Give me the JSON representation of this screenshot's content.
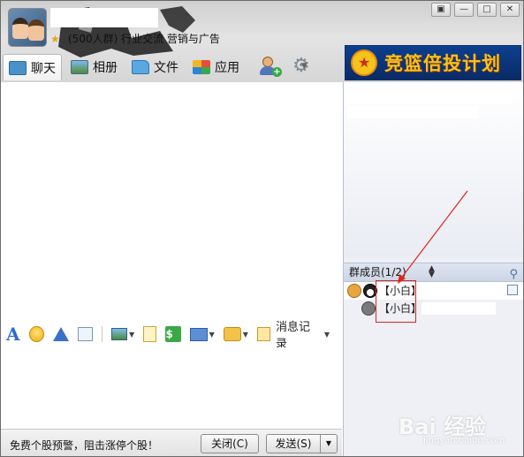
{
  "window": {
    "group_name": "",
    "group_desc": "(500人群) 行业交流 营销与广告",
    "controls": [
      "▣",
      "—",
      "□",
      "✕"
    ]
  },
  "tabs": [
    {
      "label": "聊天",
      "active": true
    },
    {
      "label": "相册",
      "active": false
    },
    {
      "label": "文件",
      "active": false
    },
    {
      "label": "应用",
      "active": false
    }
  ],
  "ad_banner": {
    "text": "竞篮倍投计划"
  },
  "toolbar": {
    "history_label": "消息记录"
  },
  "bottom": {
    "promo": "免费个股预警，阻击涨停个股！",
    "close_label": "关闭(C)",
    "send_label": "发送(S)"
  },
  "members": {
    "header": "群成员(1/2)",
    "list": [
      {
        "name": "【小白】",
        "role": "owner"
      },
      {
        "name": "【小白】",
        "role": "member"
      }
    ]
  },
  "watermark": {
    "brand": "Bai 经验",
    "url": "jingyan.baidu.com"
  },
  "colors": {
    "accent": "#e0241b",
    "ad_bg": "#0d3f8f",
    "ad_text": "#f7c21b"
  }
}
